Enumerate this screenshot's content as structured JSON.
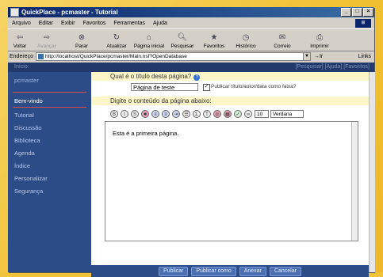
{
  "window": {
    "title": "QuickPlace - pcmaster - Tutorial"
  },
  "menu": [
    "Arquivo",
    "Editar",
    "Exibir",
    "Favoritos",
    "Ferramentas",
    "Ajuda"
  ],
  "toolbar": {
    "voltar": "Voltar",
    "avancar": "Avançar",
    "parar": "Parar",
    "atualizar": "Atualizar",
    "pagina_inicial": "Página inicial",
    "pesquisar": "Pesquisar",
    "favoritos": "Favoritos",
    "historico": "Histórico",
    "correio": "Correio",
    "imprimir": "Imprimir"
  },
  "address": {
    "label": "Endereço",
    "url": "http://localhost/QuickPlace/pcmaster/Main.nsf?OpenDatabase",
    "go": "Ir",
    "links": "Links"
  },
  "topstrip": {
    "start": "Início:",
    "links": "[Pesquisar] [Ajuda] [Favoritos]"
  },
  "sidebar": {
    "user": "pcmaster",
    "items": [
      "Bem-vindo",
      "Tutorial",
      "Discussão",
      "Biblioteca",
      "Agenda",
      "Índice",
      "Personalizar",
      "Segurança"
    ]
  },
  "form": {
    "title_question": "Qual é o título desta página?",
    "title_value": "Página de teste",
    "publish_label": "Publicar título/autor/data como faixa?",
    "publish_checked": true,
    "content_prompt": "Digite o conteúdo da página abaixo:",
    "font_size": "10",
    "font_name": "Verdana",
    "content_text": "Esta é a primeira página."
  },
  "actions": [
    "Publicar",
    "Publicar como",
    "Anexar",
    "Cancelar"
  ]
}
